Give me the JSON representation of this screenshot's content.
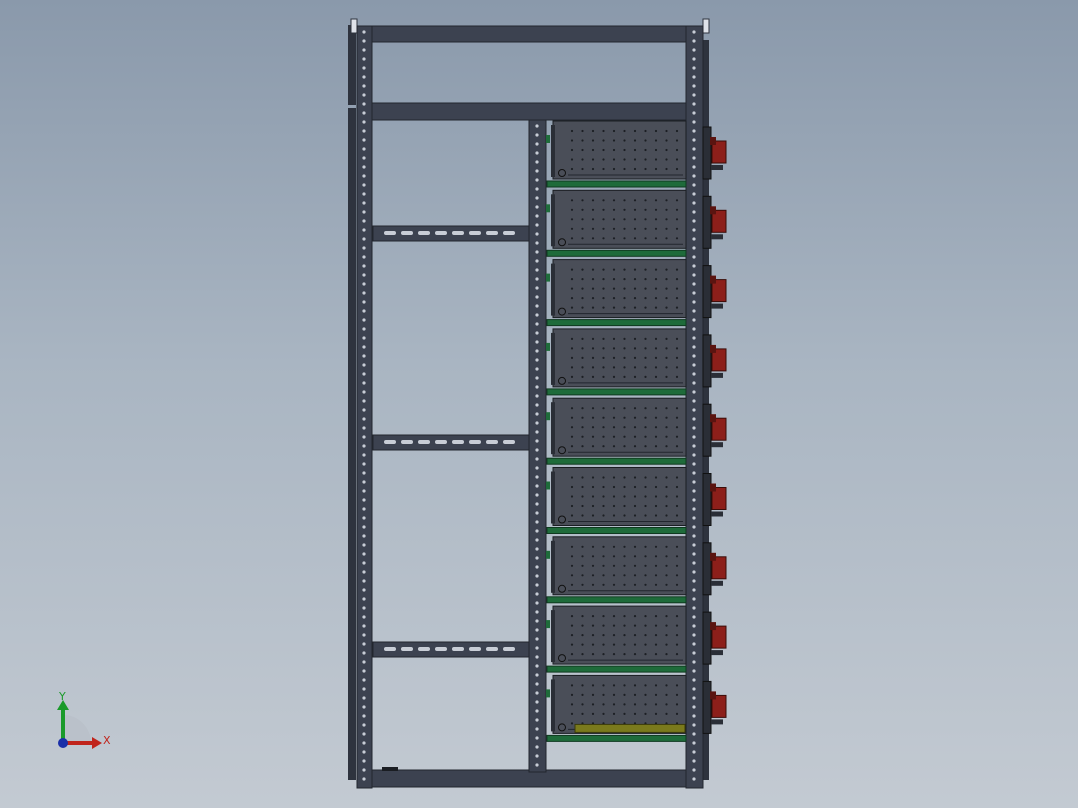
{
  "viewport": {
    "background_top": "#8a99ab",
    "background_bottom": "#c3cad2"
  },
  "model": {
    "frame_color": "#3c4250",
    "frame_hole_color": "#c8cdd6",
    "module_color": "#4a4e58",
    "module_dot_color": "#1c1f24",
    "tray_color": "#1e6b3a",
    "connector_color": "#8c1f1a",
    "battery_module_count": 9,
    "cross_bracket_count": 3,
    "last_module_bar_color": "#7a7a1c"
  },
  "triad": {
    "x_label": "X",
    "y_label": "Y",
    "x_color": "#c0241c",
    "y_color": "#1a9a2a",
    "z_color": "#1a2fa8"
  }
}
